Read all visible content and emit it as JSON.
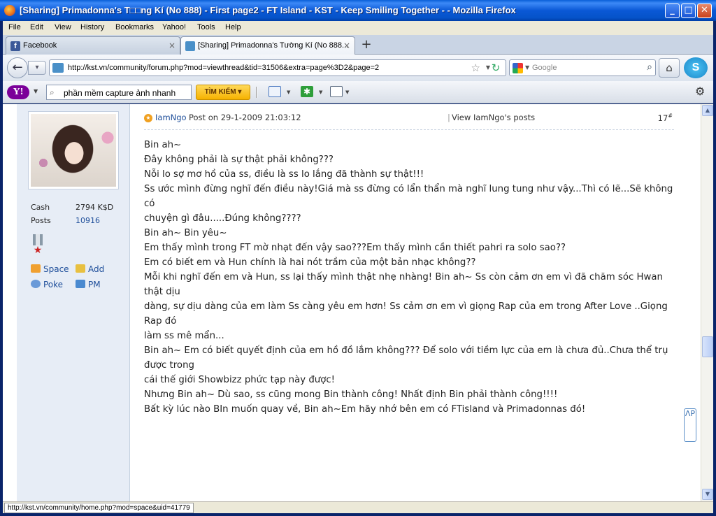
{
  "window": {
    "title": "[Sharing] Primadonna's T□□ng Kí (No 888) - First page2 - FT Island - KST - Keep Smiling Together - - Mozilla Firefox",
    "minimize": "_",
    "maximize": "□",
    "close": "✕"
  },
  "menu": {
    "items": [
      "File",
      "Edit",
      "View",
      "History",
      "Bookmarks",
      "Yahoo!",
      "Tools",
      "Help"
    ]
  },
  "tabs": [
    {
      "label": "Facebook",
      "favicon": "f",
      "close": "×",
      "active": false
    },
    {
      "label": "[Sharing] Primadonna's Tường Kí (No 888...",
      "close": "×",
      "active": true
    }
  ],
  "newtab": "+",
  "nav": {
    "back": "←",
    "forward": "▾",
    "url": "http://kst.vn/community/forum.php?mod=viewthread&tid=31506&extra=page%3D2&page=2",
    "star": "☆",
    "dropdown": "▼",
    "reload": "↻",
    "search_placeholder": "Google",
    "search_icon": "⌕",
    "home": "⌂",
    "skype": "S"
  },
  "yahoo_toolbar": {
    "logo": "Y!",
    "search_icon": "⌕",
    "search_value": "phần mềm capture ảnh nhanh",
    "search_button": "TÌM KIẾM ▾",
    "answers_icon": "✱",
    "gear": "⚙",
    "dropdown": "▼"
  },
  "profile": {
    "cash_label": "Cash",
    "cash_value": "2794 K$D",
    "posts_label": "Posts",
    "posts_value": "10916",
    "medal_star": "★",
    "links": {
      "space": "Space",
      "add": "Add",
      "poke": "Poke",
      "pm": "PM"
    }
  },
  "post": {
    "author_icon": "★",
    "author": "IamNgo",
    "meta": "Post on 29-1-2009 21:03:12",
    "separator": "|",
    "view_posts": "View IamNgo's posts",
    "floor": "17",
    "floor_mark": "#",
    "lines": [
      "Bin ah~",
      "Đây không phải là sự thật phải không???",
      "Nỗi lo sợ mơ hồ của ss, điều là ss lo lắng đã thành sự thật!!!",
      "Ss ước mình đừng nghĩ đến điều này!Giá mà ss đừng có lẩn thẩn mà nghĩ lung tung như vậy...Thì có lẽ...Sẽ không có",
      "chuyện gì đâu.....Đúng không????",
      "Bin ah~ Bin yêu~",
      "Em thấy mình trong FT mờ nhạt đến vậy sao???Em thấy mình cần thiết pahri ra solo sao??",
      "Em có biết em và Hun chính là hai nót trầm của một bản nhạc không??",
      "Mỗi khi nghĩ đến em và Hun, ss lại thấy mình thật nhẹ nhàng! Bin ah~ Ss còn cảm ơn em vì đã chăm sóc Hwan thật dịu",
      "dàng, sự dịu dàng của em làm Ss càng yêu em hơn! Ss cảm ơn em vì giọng Rap của em trong After Love ..Giọng Rap đó",
      "làm ss mê mẩn...",
      "Bin ah~ Em có biết quyết định của em hồ đồ lắm không??? Để solo với tiềm lực của em là chưa đủ..Chưa thể trụ được trong",
      "cái thế giới Showbizz phức tạp này được!",
      "Nhưng Bin ah~ Dù sao, ss cũng mong Bin thành công!  Nhất định Bin phải thành công!!!!",
      "Bất kỳ lúc nào BIn muốn quay về, Bin ah~Em hãy nhớ bên em có FTisland và Primadonnas đó!"
    ]
  },
  "scroll": {
    "up": "▲",
    "down": "▼",
    "up_badge": "ɅP"
  },
  "status": {
    "text": "http://kst.vn/community/home.php?mod=space&uid=41779"
  },
  "colors": {
    "titlebar": "#0a58d6",
    "link": "#1e4e9a",
    "sidebar": "#e7edf6",
    "yahoo_purple": "#7b0099",
    "search_button": "#f6b200"
  }
}
